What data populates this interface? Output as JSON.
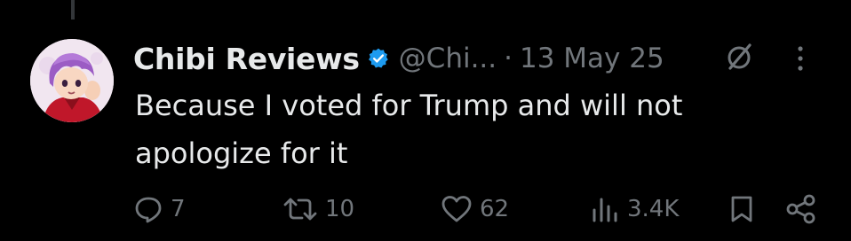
{
  "tweet": {
    "author_name": "Chibi Reviews",
    "handle": "@Chi...",
    "separator": "·",
    "date": "13 May 25",
    "text": "Because I voted for Trump and will not apologize for it"
  },
  "icons": {
    "verified": "verified-badge-icon",
    "grok": "grok-icon",
    "more": "more-icon",
    "reply": "reply-icon",
    "retweet": "retweet-icon",
    "like": "heart-icon",
    "views": "views-icon",
    "bookmark": "bookmark-icon",
    "share": "share-icon"
  },
  "actions": {
    "replies": "7",
    "retweets": "10",
    "likes": "62",
    "views": "3.4K"
  },
  "colors": {
    "background": "#000000",
    "primary_text": "#e7e9ea",
    "secondary_text": "#71767b",
    "verified": "#1d9bf0"
  }
}
